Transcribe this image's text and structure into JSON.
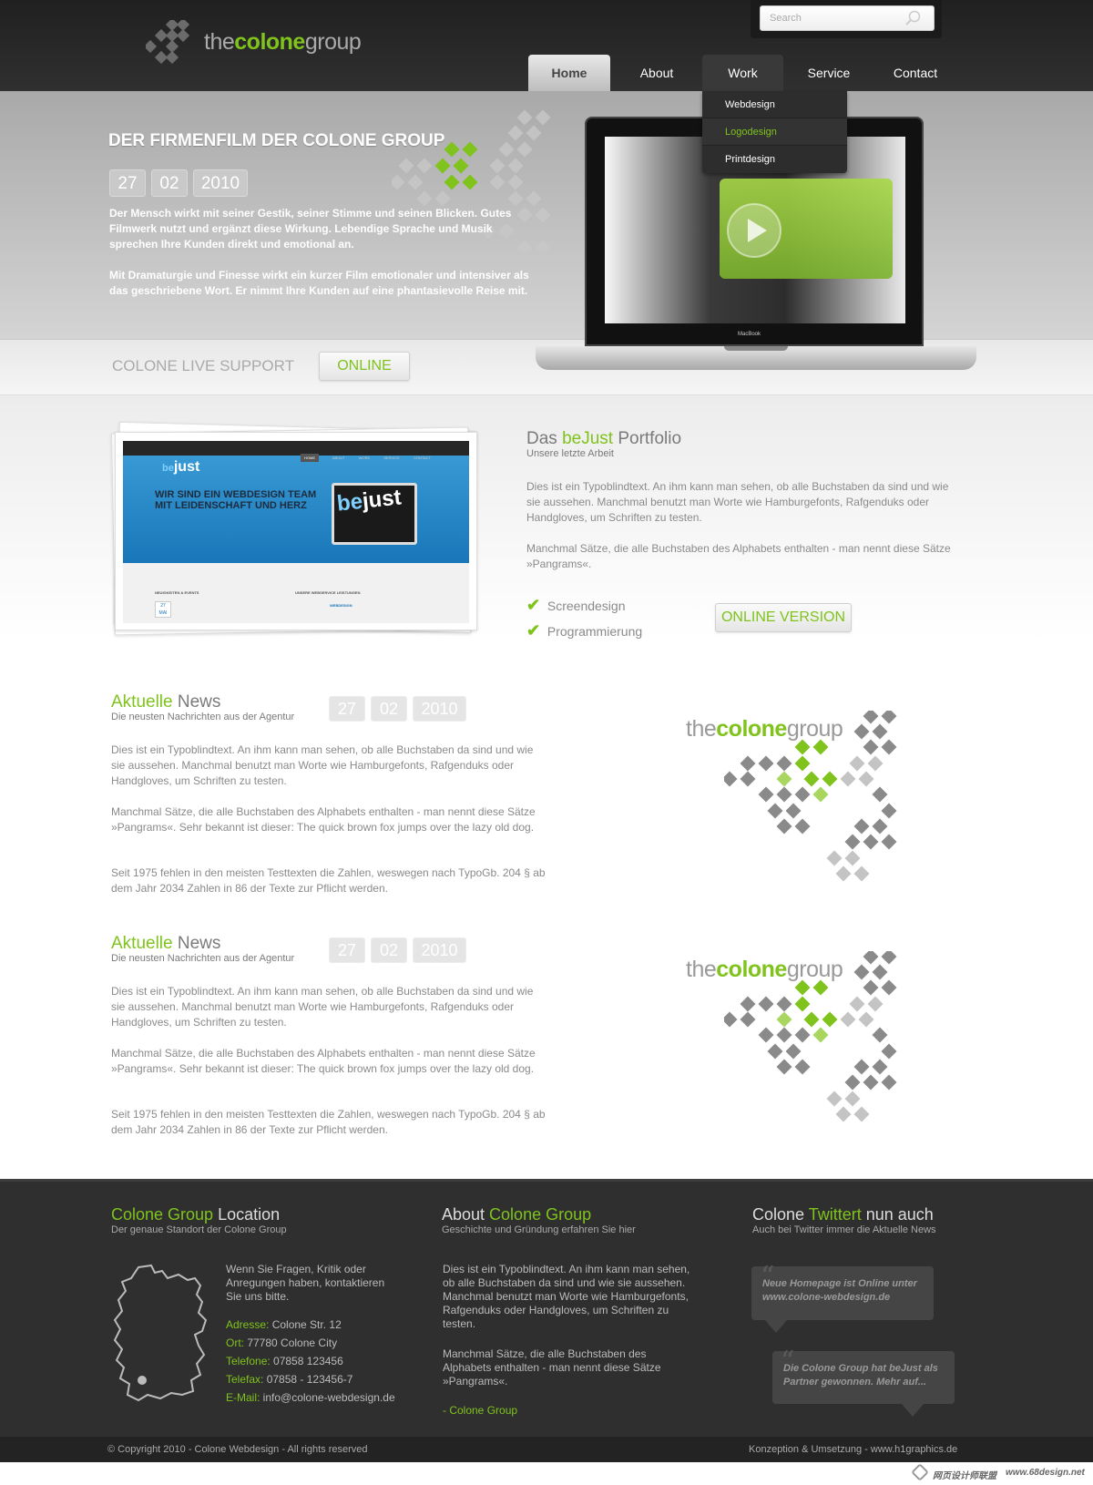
{
  "brand": {
    "pre": "the",
    "mid": "colone",
    "post": "group"
  },
  "search": {
    "placeholder": "Search"
  },
  "nav": {
    "items": [
      "Home",
      "About",
      "Work",
      "Service",
      "Contact"
    ]
  },
  "dropdown": {
    "items": [
      "Webdesign",
      "Logodesign",
      "Printdesign"
    ]
  },
  "hero": {
    "title": "DER FIRMENFILM DER COLONE GROUP",
    "date": {
      "day": "27",
      "month": "02",
      "year": "2010"
    },
    "p1": "Der Mensch wirkt mit seiner Gestik, seiner Stimme und seinen Blicken. Gutes Filmwerk nutzt und ergänzt diese Wirkung. Lebendige Sprache und Musik sprechen Ihre Kunden direkt und emotional an.",
    "p2": "Mit Dramaturgie und Finesse wirkt ein kurzer Film emotionaler und intensiver als das geschriebene Wort. Er nimmt Ihre Kunden auf eine phantasievolle Reise mit.",
    "laptop_label": "MacBook"
  },
  "support": {
    "label": "COLONE LIVE SUPPORT",
    "status": "ONLINE"
  },
  "portfolio": {
    "title_pre": "Das ",
    "title_green": "beJust",
    "title_post": " Portfolio",
    "subtitle": "Unsere letzte Arbeit",
    "p1": "Dies ist ein Typoblindtext. An ihm kann man sehen, ob alle Buchstaben da sind und wie sie aussehen. Manchmal benutzt man Worte wie Hamburgefonts, Rafgenduks oder Handgloves, um Schriften zu testen.",
    "p2": "Manchmal Sätze, die alle Buchstaben des Alphabets enthalten - man nennt diese Sätze »Pangrams«.",
    "checks": [
      "Screendesign",
      "Programmierung"
    ],
    "button": "ONLINE VERSION",
    "shot": {
      "logo": "just",
      "logo_prefix": "be",
      "headline": "WIR SIND EIN WEBDESIGN TEAM MIT LEIDENSCHAFT UND HERZ",
      "nav": [
        "HOME",
        "ABOUT",
        "WORK",
        "SERVICE",
        "CONTACT"
      ],
      "footer_left": "NEUIGKEITEN & EVENTS",
      "footer_right": "UNSERE WEBSERVICE LEISTUNGEN",
      "footer_date_day": "27",
      "footer_date_month": "MAI",
      "footer_item": "WEBDESIGN"
    }
  },
  "news": [
    {
      "title_green": "Aktuelle",
      "title_rest": " News",
      "subtitle": "Die neusten Nachrichten aus der Agentur",
      "date": {
        "day": "27",
        "month": "02",
        "year": "2010"
      },
      "p1": "Dies ist ein Typoblindtext. An ihm kann man sehen, ob alle Buchstaben da sind und wie sie aussehen. Manchmal benutzt man Worte wie Hamburgefonts, Rafgenduks oder Handgloves, um Schriften zu testen.",
      "p2": "Manchmal Sätze, die alle Buchstaben des Alphabets enthalten - man nennt diese Sätze »Pangrams«. Sehr bekannt ist dieser: The quick brown fox jumps over the lazy old dog.",
      "p3": "Seit 1975 fehlen in den meisten Testtexten die Zahlen, weswegen nach TypoGb. 204 § ab dem Jahr 2034 Zahlen in 86 der Texte zur Pflicht werden."
    },
    {
      "title_green": "Aktuelle",
      "title_rest": " News",
      "subtitle": "Die neusten Nachrichten aus der Agentur",
      "date": {
        "day": "27",
        "month": "02",
        "year": "2010"
      },
      "p1": "Dies ist ein Typoblindtext. An ihm kann man sehen, ob alle Buchstaben da sind und wie sie aussehen. Manchmal benutzt man Worte wie Hamburgefonts, Rafgenduks oder Handgloves, um Schriften zu testen.",
      "p2": "Manchmal Sätze, die alle Buchstaben des Alphabets enthalten - man nennt diese Sätze »Pangrams«. Sehr bekannt ist dieser: The quick brown fox jumps over the lazy old dog.",
      "p3": "Seit 1975 fehlen in den meisten Testtexten die Zahlen, weswegen nach TypoGb. 204 § ab dem Jahr 2034 Zahlen in 86 der Texte zur Pflicht werden."
    }
  ],
  "footer": {
    "location": {
      "title_green": "Colone Group",
      "title_rest": " Location",
      "subtitle": "Der genaue Standort der Colone Group",
      "intro": "Wenn Sie Fragen, Kritik oder Anregungen haben, kontaktieren Sie uns bitte.",
      "rows": [
        {
          "label": "Adresse:",
          "value": " Colone Str. 12"
        },
        {
          "label": "Ort:",
          "value": " 77780 Colone City"
        },
        {
          "label": "Telefone:",
          "value": " 07858 123456"
        },
        {
          "label": "Telefax:",
          "value": " 07858 - 123456-7"
        },
        {
          "label": "E-Mail:",
          "value": " info@colone-webdesign.de"
        }
      ]
    },
    "about": {
      "title_pre": "About ",
      "title_green": "Colone Group",
      "subtitle": "Geschichte und Gründung erfahren Sie hier",
      "p1": "Dies ist ein Typoblindtext. An ihm kann man sehen, ob alle Buchstaben da sind und wie sie aussehen. Manchmal benutzt man Worte wie Hamburgefonts, Rafgenduks oder Handgloves, um Schriften zu testen.",
      "p2": "Manchmal Sätze, die alle Buchstaben des Alphabets enthalten - man nennt diese Sätze »Pangrams«.",
      "signature": "- Colone Group"
    },
    "twitter": {
      "title_pre": "Colone ",
      "title_green": "Twittert",
      "title_post": " nun auch",
      "subtitle": "Auch bei Twitter immer die Aktuelle News",
      "tweets": [
        "Neue Homepage ist Online unter www.colone-webdesign.de",
        "Die Colone Group hat beJust als Partner gewonnen. Mehr auf..."
      ]
    }
  },
  "bottom": {
    "copyright": "© Copyright 2010 - Colone Webdesign - All rights reserved",
    "credit": "Konzeption & Umsetzung - www.h1graphics.de"
  },
  "watermark": {
    "text": "网页设计师联盟",
    "url": "www.68design.net"
  },
  "colors": {
    "accent": "#7fc31c",
    "dark": "#2f2f2f",
    "gray": "#8a8a8a"
  }
}
